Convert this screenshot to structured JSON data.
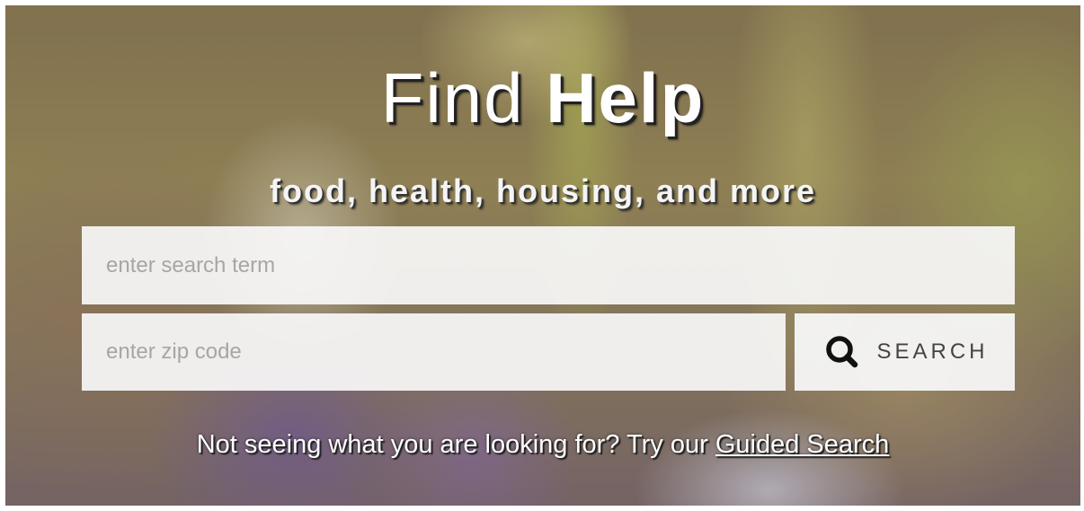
{
  "hero": {
    "title_light": "Find",
    "title_bold": "Help",
    "subtitle": "food, health, housing, and more"
  },
  "search": {
    "term_placeholder": "enter search term",
    "term_value": "",
    "zip_placeholder": "enter zip code",
    "zip_value": "",
    "button_label": "SEARCH",
    "button_icon": "search-icon"
  },
  "footer": {
    "prompt_text": "Not seeing what you are looking for? Try our",
    "link_text": "Guided Search"
  },
  "colors": {
    "text_light": "#ffffff",
    "input_bg": "#f7f7f7",
    "placeholder": "#a6a6a6",
    "button_text": "#444444"
  }
}
